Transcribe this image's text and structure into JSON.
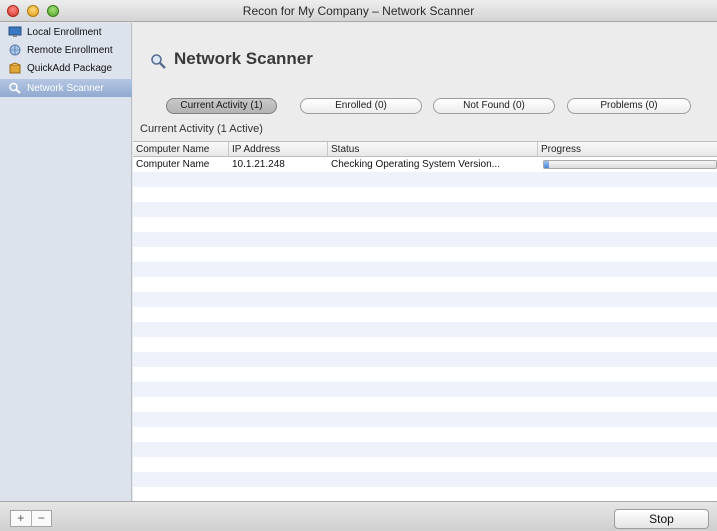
{
  "window": {
    "title": "Recon for My Company – Network Scanner"
  },
  "sidebar": {
    "items": [
      {
        "label": "Local Enrollment",
        "icon": "monitor-icon",
        "selected": false
      },
      {
        "label": "Remote Enrollment",
        "icon": "globe-icon",
        "selected": false
      },
      {
        "label": "QuickAdd Package",
        "icon": "package-icon",
        "selected": false
      },
      {
        "label": "Network Scanner",
        "icon": "search-icon",
        "selected": true
      }
    ]
  },
  "main": {
    "title": "Network Scanner",
    "tabs": [
      {
        "label": "Current Activity (1)",
        "active": true
      },
      {
        "label": "Enrolled (0)",
        "active": false
      },
      {
        "label": "Not Found (0)",
        "active": false
      },
      {
        "label": "Problems (0)",
        "active": false
      }
    ],
    "section_label": "Current Activity (1 Active)",
    "table": {
      "columns": [
        "Computer Name",
        "IP Address",
        "Status",
        "Progress"
      ],
      "rows": [
        {
          "computer_name": "Computer Name",
          "ip_address": "10.1.21.248",
          "status": "Checking Operating System Version...",
          "progress": 0.03
        }
      ]
    }
  },
  "bottom": {
    "add_label": "+",
    "remove_label": "−",
    "stop_label": "Stop"
  },
  "colors": {
    "selection": "#92aad1",
    "progress": "#4d86d6",
    "stripe": "#eef3fb"
  }
}
